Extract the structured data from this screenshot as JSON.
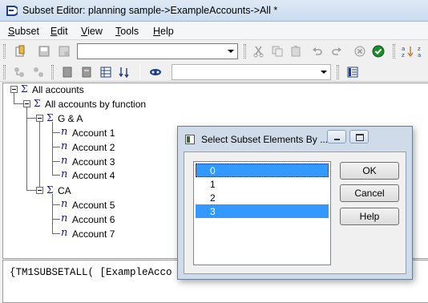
{
  "window": {
    "title": "Subset Editor:  planning sample->ExampleAccounts->All  *"
  },
  "menu": [
    {
      "hotkey": "S",
      "rest": "ubset"
    },
    {
      "hotkey": "E",
      "rest": "dit"
    },
    {
      "hotkey": "V",
      "rest": "iew"
    },
    {
      "hotkey": "T",
      "rest": "ools"
    },
    {
      "hotkey": "H",
      "rest": "elp"
    }
  ],
  "toolbar": {
    "alias_combo_value": "",
    "filter_combo_value": ""
  },
  "tree": {
    "root": "All accounts",
    "by_function": "All accounts by function",
    "group1": "G & A",
    "group2": "CA",
    "accounts": [
      "Account 1",
      "Account 2",
      "Account 3",
      "Account 4",
      "Account 5",
      "Account 6",
      "Account 7"
    ],
    "consolidated_symbol": "Σ",
    "leaf_symbol": "n"
  },
  "expression": {
    "text": "{TM1SUBSETALL( [ExampleAcco"
  },
  "dialog": {
    "title": "Select Subset Elements By ...",
    "options": [
      {
        "label": "0",
        "selected": true
      },
      {
        "label": "1",
        "selected": false
      },
      {
        "label": "2",
        "selected": false
      },
      {
        "label": "3",
        "selected": true
      }
    ],
    "ok": "OK",
    "cancel": "Cancel",
    "help": "Help"
  },
  "colors": {
    "selection": "#3399ff",
    "dialog_frame": "#cfdbe9",
    "tree_symbol": "#1a1a8a"
  }
}
